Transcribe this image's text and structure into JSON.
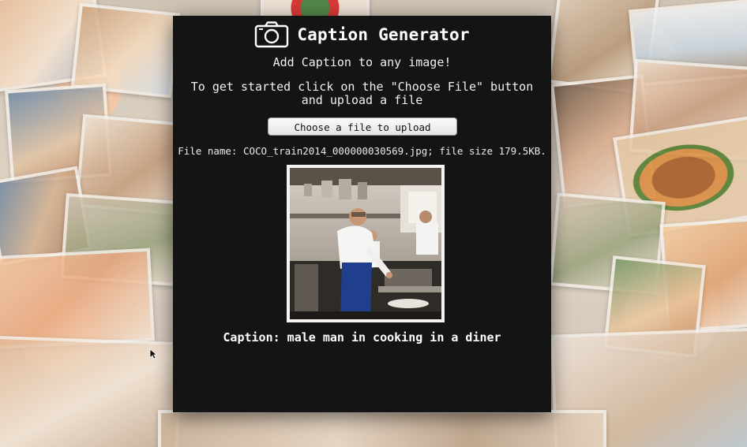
{
  "app": {
    "title": "Caption Generator",
    "subtitle": "Add Caption to any image!",
    "instructions": "To get started click on the \"Choose File\" button and upload a file"
  },
  "upload": {
    "button_label": "Choose a file to upload"
  },
  "file": {
    "info": "File name: COCO_train2014_000000030569.jpg; file size 179.5KB."
  },
  "result": {
    "caption": "Caption: male man in cooking in a diner"
  },
  "icons": {
    "header": "camera-icon",
    "pointer": "cursor-arrow-icon"
  },
  "colors": {
    "panel_background": "#141414",
    "text": "#f2f2f2",
    "button_background": "#f0f0f0"
  }
}
